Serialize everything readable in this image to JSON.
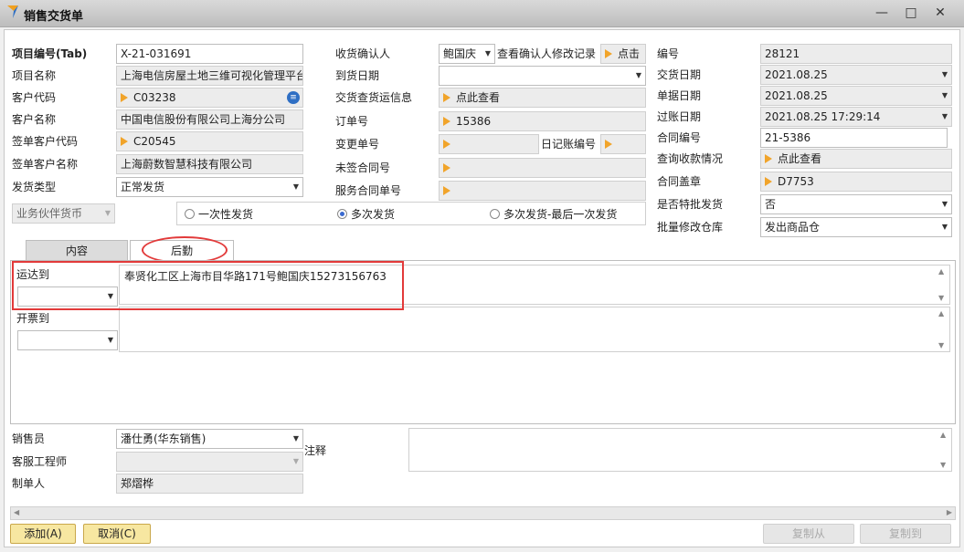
{
  "window": {
    "title": "销售交货单"
  },
  "left": {
    "project_no_label": "项目编号(Tab)",
    "project_no": "X-21-031691",
    "project_name_label": "项目名称",
    "project_name": "上海电信房屋土地三维可视化管理平台",
    "customer_code_label": "客户代码",
    "customer_code": "C03238",
    "customer_name_label": "客户名称",
    "customer_name": "中国电信股份有限公司上海分公司",
    "sign_code_label": "签单客户代码",
    "sign_code": "C20545",
    "sign_name_label": "签单客户名称",
    "sign_name": "上海蔚数智慧科技有限公司",
    "ship_type_label": "发货类型",
    "ship_type": "正常发货",
    "currency_label": "业务伙伴货币"
  },
  "middle": {
    "receiver_label": "收货确认人",
    "receiver": "鲍国庆",
    "view_modify_label": "查看确认人修改记录",
    "click_label": "点击",
    "arrival_date_label": "到货日期",
    "arrival_date": "",
    "transport_label": "交货查货运信息",
    "transport_value": "点此查看",
    "order_no_label": "订单号",
    "order_no": "15386",
    "change_no_label": "变更单号",
    "change_no": "",
    "journal_label": "日记账编号",
    "unsigned_label": "未签合同号",
    "service_label": "服务合同单号"
  },
  "right": {
    "number_label": "编号",
    "number": "28121",
    "delivery_date_label": "交货日期",
    "delivery_date": "2021.08.25",
    "doc_date_label": "单据日期",
    "doc_date": "2021.08.25",
    "post_date_label": "过账日期",
    "post_date": "2021.08.25 17:29:14",
    "contract_no_label": "合同编号",
    "contract_no": "21-5386",
    "payment_label": "查询收款情况",
    "payment_value": "点此查看",
    "contract_seal_label": "合同盖章",
    "contract_seal": "D7753",
    "special_label": "是否特批发货",
    "special": "否",
    "warehouse_label": "批量修改仓库",
    "warehouse": "发出商品仓"
  },
  "shipping_options": [
    {
      "label": "一次性发货",
      "selected": false
    },
    {
      "label": "多次发货",
      "selected": true
    },
    {
      "label": "多次发货-最后一次发货",
      "selected": false
    }
  ],
  "tabs": [
    {
      "label": "内容"
    },
    {
      "label": "后勤"
    }
  ],
  "logistics": {
    "ship_to_label": "运达到",
    "ship_to_address": "奉贤化工区上海市目华路171号鲍国庆15273156763",
    "bill_to_label": "开票到"
  },
  "footer": {
    "sales_label": "销售员",
    "sales": "潘仕勇(华东销售)",
    "service_eng_label": "客服工程师",
    "service_eng": "",
    "creator_label": "制单人",
    "creator": "郑熠桦",
    "remark_label": "注释"
  },
  "buttons": {
    "add": "添加(A)",
    "cancel": "取消(C)",
    "copy_from": "复制从",
    "copy_to": "复制到"
  },
  "colors": {
    "accent_red": "#e23a3a",
    "button_yellow": "#f7e7a1",
    "arrow_orange": "#f1a42a"
  }
}
